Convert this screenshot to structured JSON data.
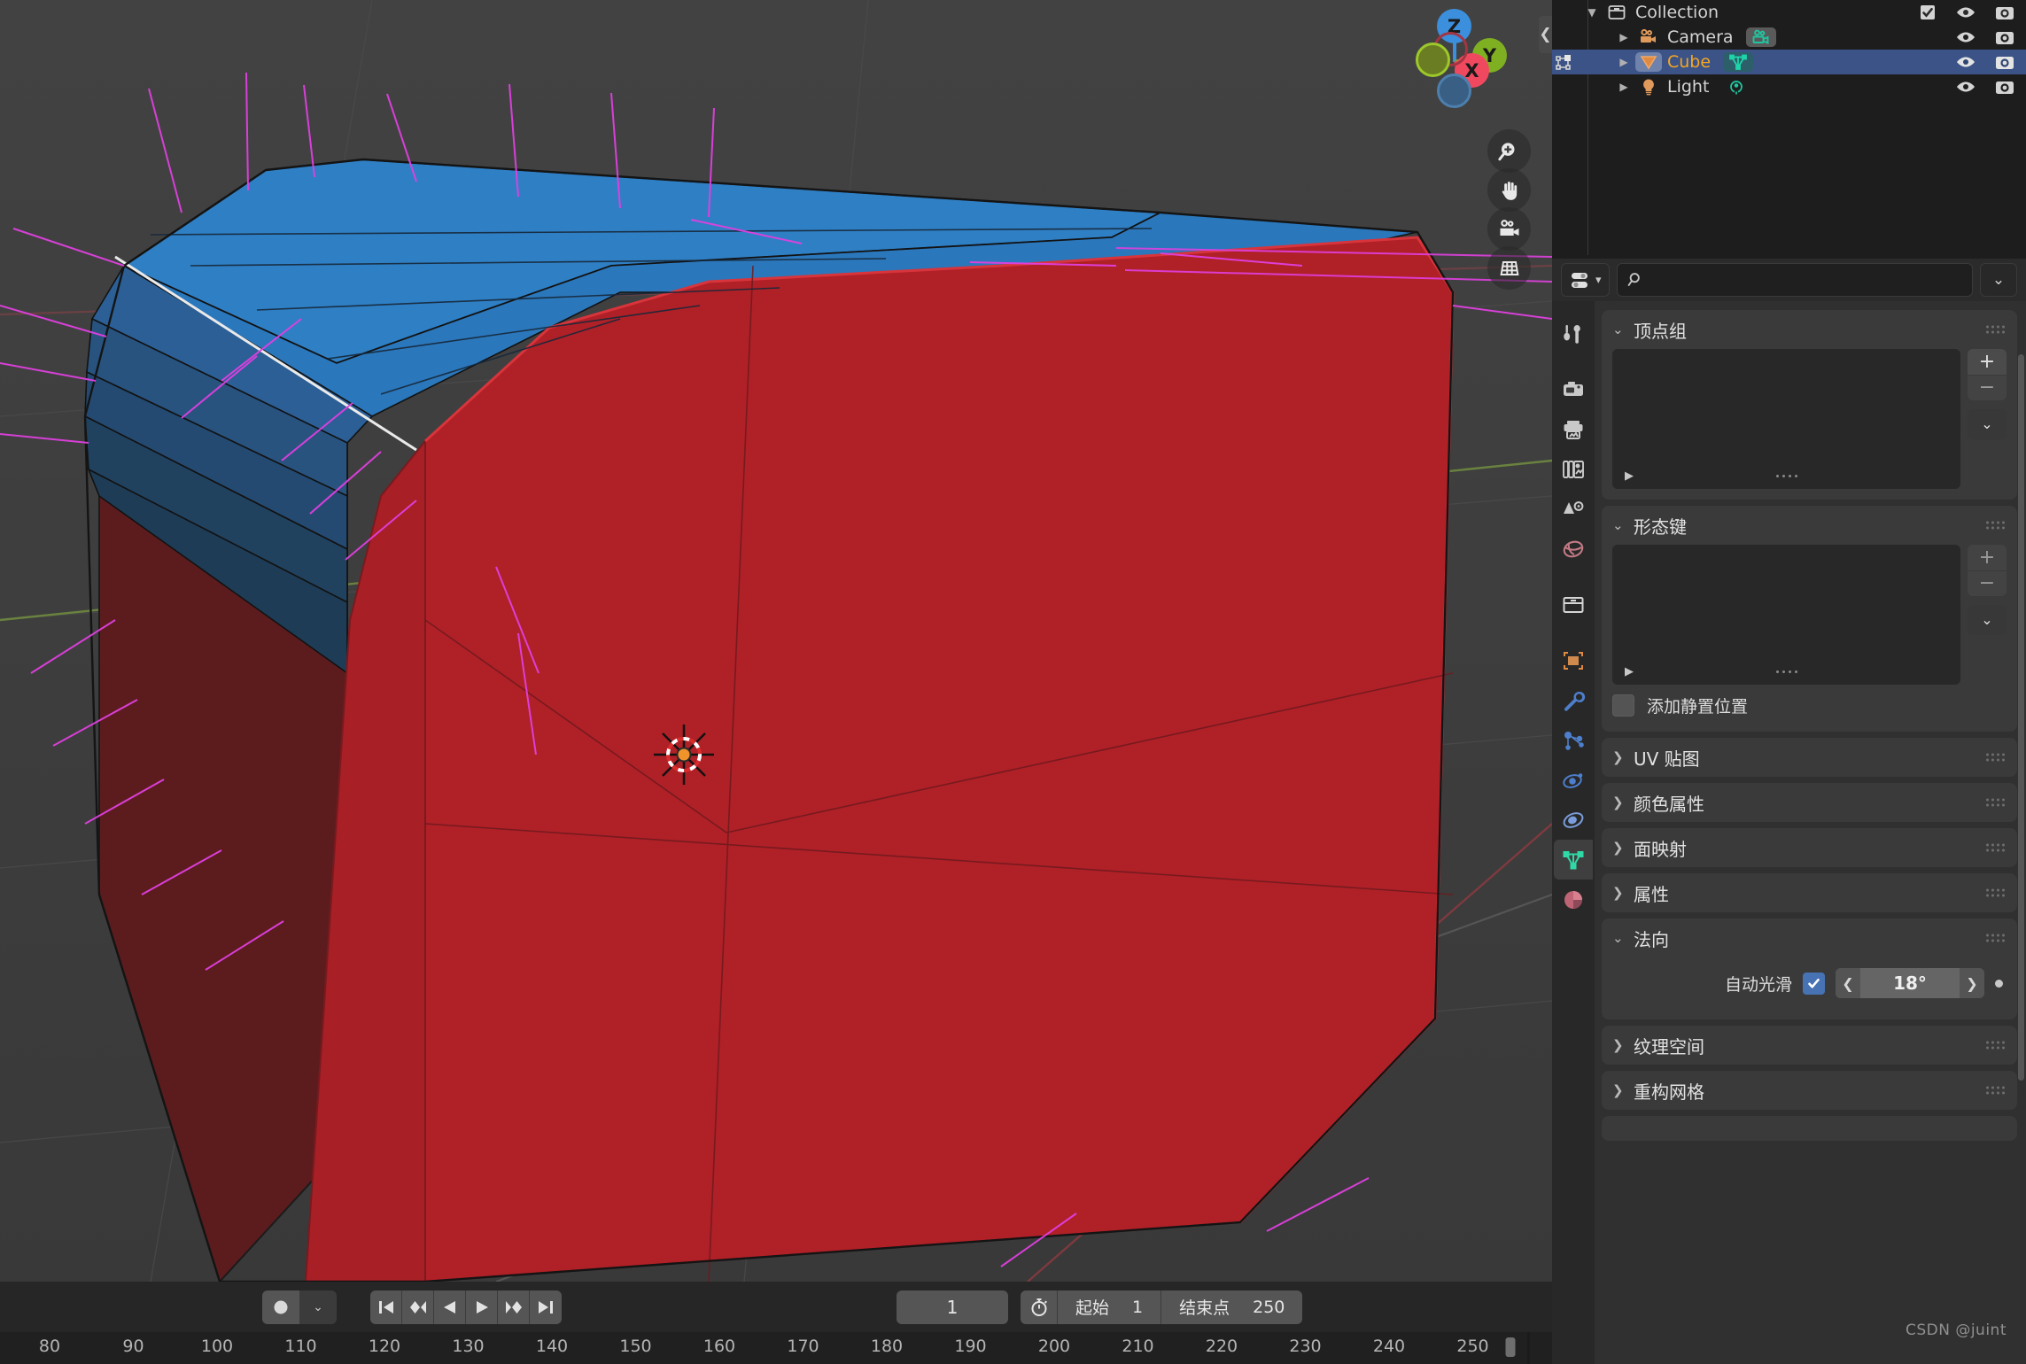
{
  "app": {
    "name": "Blender",
    "theme_bg": "#303030",
    "accent": "#4772b3"
  },
  "outliner": {
    "collection": {
      "label": "Collection",
      "expanded": true
    },
    "items": [
      {
        "label": "Camera",
        "type": "camera",
        "selected": false,
        "data_icon": "camera-data-icon"
      },
      {
        "label": "Cube",
        "type": "mesh",
        "selected": true,
        "data_icon": "mesh-data-icon"
      },
      {
        "label": "Light",
        "type": "light",
        "selected": false,
        "data_icon": "light-data-icon"
      }
    ],
    "toggles": {
      "visibility": "eye-icon",
      "render": "camera-render-icon",
      "checkbox": "checked"
    }
  },
  "viewport": {
    "gizmo": {
      "z": "Z",
      "y": "Y",
      "x": "X"
    },
    "buttons": [
      "zoom-icon",
      "pan-hand-icon",
      "camera-view-icon",
      "ortho-persp-icon"
    ],
    "cursor": "3d-cursor"
  },
  "properties": {
    "header": {
      "editor_type": "properties-editor-icon",
      "search_placeholder": "",
      "search_value": "",
      "options_icon": "chevron-down-icon"
    },
    "tabs": [
      {
        "name": "tool",
        "icon": "tool-icon",
        "active": false
      },
      {
        "name": "render",
        "icon": "render-camera-icon",
        "active": false
      },
      {
        "name": "output",
        "icon": "output-printer-icon",
        "active": false
      },
      {
        "name": "viewlayer",
        "icon": "view-layer-icon",
        "active": false
      },
      {
        "name": "scene",
        "icon": "scene-cone-icon",
        "active": false
      },
      {
        "name": "world",
        "icon": "world-globe-icon",
        "active": false
      },
      {
        "name": "collection",
        "icon": "collection-box-icon",
        "active": false
      },
      {
        "name": "object",
        "icon": "object-square-icon",
        "active": false
      },
      {
        "name": "modifiers",
        "icon": "wrench-icon",
        "active": false
      },
      {
        "name": "particles",
        "icon": "particles-icon",
        "active": false
      },
      {
        "name": "physics",
        "icon": "physics-orbit-icon",
        "active": false
      },
      {
        "name": "constraints",
        "icon": "constraint-icon",
        "active": false
      },
      {
        "name": "data",
        "icon": "mesh-data-icon",
        "active": true
      },
      {
        "name": "material",
        "icon": "material-sphere-icon",
        "active": false
      }
    ],
    "panels": [
      {
        "title": "顶点组",
        "expanded": true,
        "kind": "list"
      },
      {
        "title": "形态键",
        "expanded": true,
        "kind": "list_shapekey"
      },
      {
        "title": "UV 贴图",
        "expanded": false,
        "kind": "header"
      },
      {
        "title": "颜色属性",
        "expanded": false,
        "kind": "header"
      },
      {
        "title": "面映射",
        "expanded": false,
        "kind": "header"
      },
      {
        "title": "属性",
        "expanded": false,
        "kind": "header"
      },
      {
        "title": "法向",
        "expanded": true,
        "kind": "normals"
      },
      {
        "title": "纹理空间",
        "expanded": false,
        "kind": "header"
      },
      {
        "title": "重构网格",
        "expanded": false,
        "kind": "header"
      }
    ],
    "shapekey_extra": {
      "label": "添加静置位置",
      "checked": false
    },
    "normals": {
      "auto_smooth_label": "自动光滑",
      "auto_smooth_checked": true,
      "angle_value": "18°",
      "prev_icon": "chevron-left-icon",
      "next_icon": "chevron-right-icon",
      "animate_dot": "animate-property-dot"
    },
    "list_buttons": {
      "add": "+",
      "remove": "−",
      "more": "chevron-down-icon"
    }
  },
  "timeline": {
    "record_button": "record-icon",
    "record_dropdown": "chevron-down-icon",
    "playback": [
      {
        "name": "jump-to-start-button",
        "icon": "jump-start-icon"
      },
      {
        "name": "prev-keyframe-button",
        "icon": "prev-keyframe-icon"
      },
      {
        "name": "play-reverse-button",
        "icon": "play-reverse-icon"
      },
      {
        "name": "play-button",
        "icon": "play-icon"
      },
      {
        "name": "next-keyframe-button",
        "icon": "next-keyframe-icon"
      },
      {
        "name": "jump-to-end-button",
        "icon": "jump-end-icon"
      }
    ],
    "current_frame": "1",
    "clock_icon": "stopwatch-icon",
    "start_label": "起始",
    "start_value": "1",
    "end_label": "结束点",
    "end_value": "250",
    "ruler_ticks": [
      "80",
      "90",
      "100",
      "110",
      "120",
      "130",
      "140",
      "150",
      "160",
      "170",
      "180",
      "190",
      "200",
      "210",
      "220",
      "230",
      "240",
      "250"
    ]
  },
  "watermark": "CSDN @juint"
}
